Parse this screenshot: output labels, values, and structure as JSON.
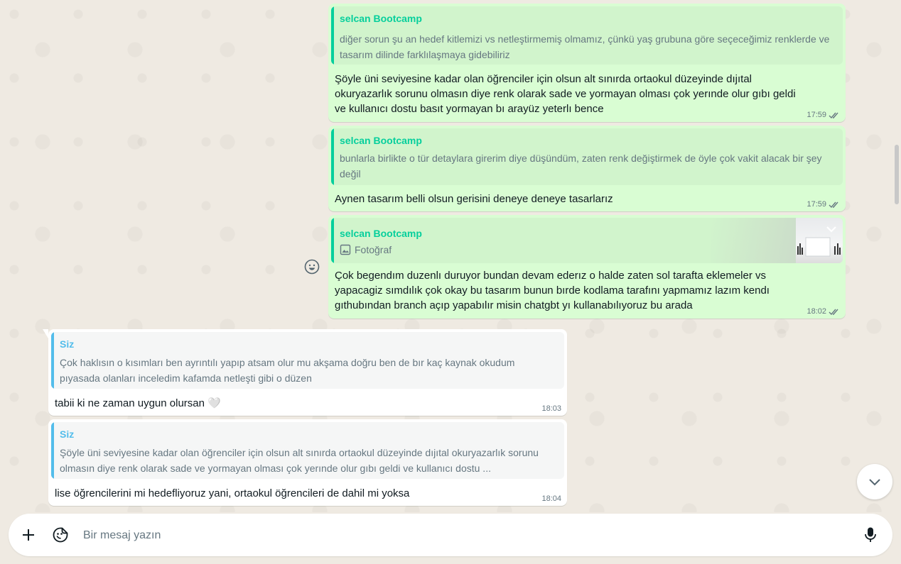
{
  "messages": [
    {
      "direction": "outgoing",
      "quote": {
        "author": "selcan Bootcamp",
        "text": "diğer sorun şu an hedef kitlemizi vs netleştirmemiş olmamız, çünkü yaş grubuna göre seçeceğimiz renklerde ve tasarım dilinde farklılaşmaya gidebiliriz"
      },
      "text": "Şöyle üni seviyesine kadar olan öğrenciler için olsun alt sınırda ortaokul düzeyinde dıjıtal okuryazarlık sorunu olmasın diye renk olarak sade ve yormayan olması çok yerınde olur gıbı geldi ve kullanıcı dostu basıt yormayan bı arayüz yeterlı bence",
      "time": "17:59"
    },
    {
      "direction": "outgoing",
      "quote": {
        "author": "selcan Bootcamp",
        "text": "bunlarla birlikte o tür detaylara girerim diye düşündüm, zaten renk değiştirmek de öyle çok vakit alacak bir şey değil"
      },
      "text": "Aynen tasarım belli olsun gerisini deneye deneye tasarlarız",
      "time": "17:59"
    },
    {
      "direction": "outgoing",
      "quote": {
        "author": "selcan Bootcamp",
        "text": "Fotoğraf"
      },
      "text": "Çok begendım duzenlı duruyor bundan devam ederız o halde zaten sol tarafta eklemeler vs yapacagiz sımdılık çok okay bu tasarım bunun bırde kodlama tarafını yapmamız lazım kendı gıthubından branch açıp yapabılır misin chatgbt yı kullanabılıyoruz bu arada",
      "time": "18:02"
    },
    {
      "direction": "incoming",
      "quote": {
        "author": "Siz",
        "text": "Çok haklısın o kısımları ben ayrıntılı yapıp atsam olur mu akşama doğru ben de bır kaç kaynak okudum pıyasada olanları inceledim kafamda netleşti gibi o düzen"
      },
      "text": "tabii ki ne zaman uygun olursan 🤍",
      "time": "18:03"
    },
    {
      "direction": "incoming",
      "quote": {
        "author": "Siz",
        "text": "Şöyle üni seviyesine kadar olan öğrenciler için olsun alt sınırda ortaokul düzeyinde dıjıtal okuryazarlık sorunu olmasın diye renk olarak sade ve yormayan olması çok yerınde olur gıbı geldi ve kullanıcı dostu ..."
      },
      "text": "lise öğrencilerini mi hedefliyoruz yani, ortaokul öğrencileri de dahil mi yoksa",
      "time": "18:04"
    }
  ],
  "composer": {
    "placeholder": "Bir mesaj yazın"
  },
  "icons": {
    "attach": "plus-icon",
    "sticker": "sticker-icon",
    "mic": "microphone-icon",
    "scroll": "chevron-down-icon",
    "react": "emoji-icon",
    "photo": "image-icon",
    "read": "double-check-icon"
  },
  "colors": {
    "outgoing_bubble": "#d9fdd3",
    "incoming_bubble": "#ffffff",
    "outgoing_quote_accent": "#06cf9c",
    "incoming_quote_accent": "#53bdeb",
    "background": "#efeae2",
    "read_ticks": "#667781"
  }
}
